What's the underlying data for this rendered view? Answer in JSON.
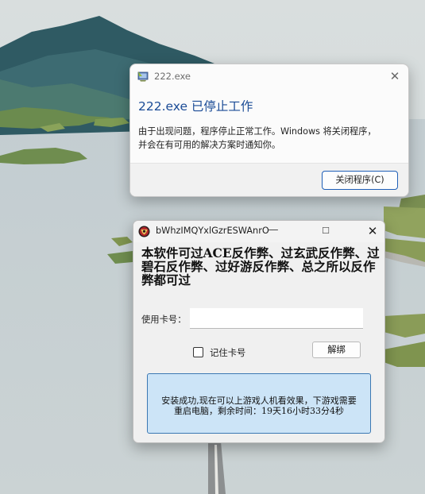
{
  "desktop": {
    "wallpaper": "coastal-road-mountains"
  },
  "crash_dialog": {
    "title": "222.exe",
    "heading": "222.exe 已停止工作",
    "message_line1": "由于出现问题，程序停止正常工作。Windows 将关闭程序，",
    "message_line2": "并会在有可用的解决方案时通知你。",
    "close_program_button": "关闭程序(C)",
    "close_glyph": "✕",
    "accent_color": "#1a4b96"
  },
  "tool_window": {
    "title": "bWhzIMQYxlGzrESWAnrO",
    "headline": "本软件可过ACE反作弊、过玄武反作弊、过碧石反作弊、过好游反作弊、总之所以反作弊都可过",
    "card_label": "使用卡号：",
    "card_input_value": "",
    "remember_label": "记住卡号",
    "remember_checked": false,
    "unbind_button": "解绑",
    "status_line1": "安装成功,现在可以上游戏人机看效果，下游戏需要",
    "status_line2": "重启电脑，剩余时间：19天16小时33分4秒",
    "min_glyph": "—",
    "max_glyph": "☐",
    "close_glyph": "✕",
    "status_bg": "#cce4f7",
    "status_border": "#3c79b3"
  }
}
